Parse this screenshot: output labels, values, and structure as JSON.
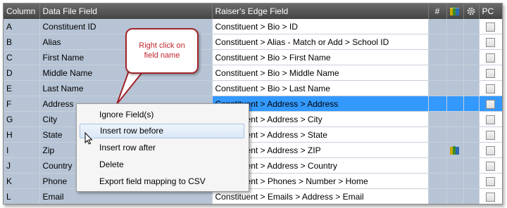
{
  "table": {
    "headers": {
      "column": "Column",
      "data_file_field": "Data File Field",
      "re_field": "Raiser's Edge Field",
      "hash": "#",
      "pc": "PC"
    },
    "rows": [
      {
        "col": "A",
        "field": "Constituent ID",
        "re": "Constituent > Bio > ID"
      },
      {
        "col": "B",
        "field": "Alias",
        "re": "Constituent > Alias - Match or Add > School ID"
      },
      {
        "col": "C",
        "field": "First Name",
        "re": "Constituent > Bio > First Name"
      },
      {
        "col": "D",
        "field": "Middle Name",
        "re": "Constituent > Bio > Middle Name"
      },
      {
        "col": "E",
        "field": "Last Name",
        "re": "Constituent > Bio > Last Name"
      },
      {
        "col": "F",
        "field": "Address",
        "re": "Constituent > Address > Address"
      },
      {
        "col": "G",
        "field": "City",
        "re": "Constituent > Address > City"
      },
      {
        "col": "H",
        "field": "State",
        "re": "Constituent > Address > State"
      },
      {
        "col": "I",
        "field": "Zip",
        "re": "Constituent > Address > ZIP"
      },
      {
        "col": "J",
        "field": "Country",
        "re": "Constituent > Address > Country"
      },
      {
        "col": "K",
        "field": "Phone",
        "re": "Constituent > Phones > Number > Home"
      },
      {
        "col": "L",
        "field": "Email",
        "re": "Constituent > Emails > Address > Email"
      }
    ]
  },
  "callout": {
    "line1": "Right click on",
    "line2": "field name"
  },
  "context_menu": {
    "items": [
      "Ignore Field(s)",
      "Insert row before",
      "Insert row after",
      "Delete",
      "Export field mapping to CSV"
    ]
  },
  "colors": {
    "header_bg": "#555555",
    "column_bg": "#b7c4d5",
    "selection": "#3399ff",
    "callout_border": "#a0242a"
  }
}
